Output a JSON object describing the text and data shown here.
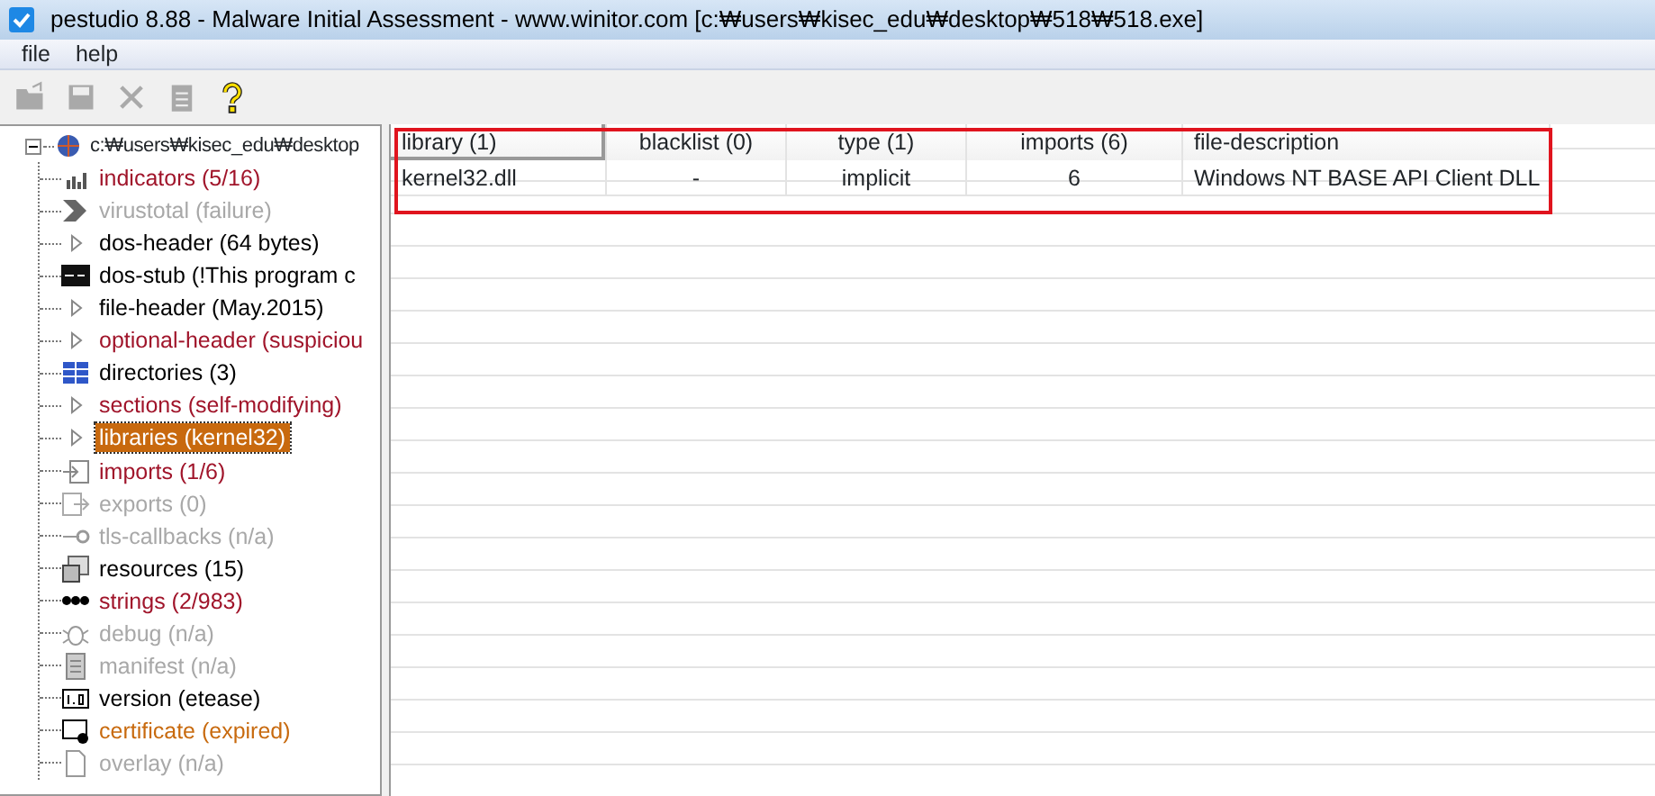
{
  "window": {
    "title": "pestudio 8.88 - Malware Initial Assessment - www.winitor.com [c:₩users₩kisec_edu₩desktop₩518₩518.exe]"
  },
  "menu": [
    "file",
    "help"
  ],
  "toolbar": [
    {
      "kind": "open",
      "disabled": true
    },
    {
      "kind": "save",
      "disabled": true
    },
    {
      "kind": "close",
      "disabled": true
    },
    {
      "kind": "clipboard",
      "disabled": true
    },
    {
      "kind": "help",
      "disabled": false
    }
  ],
  "tree": {
    "label": "c:₩users₩kisec_edu₩desktop",
    "expanded": true,
    "children": [
      {
        "label": "indicators (5/16)",
        "kind": "bars",
        "color": "#a0142a",
        "selected": false
      },
      {
        "label": "virustotal (failure)",
        "kind": "chevron",
        "color": "#a8a8a8",
        "selected": false
      },
      {
        "label": "dos-header (64 bytes)",
        "kind": "triangle",
        "color": "#000000",
        "selected": false
      },
      {
        "label": "dos-stub (!This program c",
        "kind": "console",
        "color": "#000000",
        "selected": false
      },
      {
        "label": "file-header (May.2015)",
        "kind": "triangle",
        "color": "#000000",
        "selected": false
      },
      {
        "label": "optional-header (suspiciou",
        "kind": "triangle",
        "color": "#a0142a",
        "selected": false
      },
      {
        "label": "directories (3)",
        "kind": "grid",
        "color": "#000000",
        "selected": false
      },
      {
        "label": "sections (self-modifying)",
        "kind": "triangle",
        "color": "#a0142a",
        "selected": false
      },
      {
        "label": "libraries (kernel32)",
        "kind": "triangle",
        "selected": true
      },
      {
        "label": "imports (1/6)",
        "kind": "import",
        "color": "#a0142a",
        "selected": false
      },
      {
        "label": "exports (0)",
        "kind": "export",
        "color": "#a8a8a8",
        "selected": false
      },
      {
        "label": "tls-callbacks (n/a)",
        "kind": "key",
        "color": "#a8a8a8",
        "selected": false
      },
      {
        "label": "resources (15)",
        "kind": "resources",
        "color": "#000000",
        "selected": false
      },
      {
        "label": "strings (2/983)",
        "kind": "abc",
        "color": "#a0142a",
        "selected": false
      },
      {
        "label": "debug (n/a)",
        "kind": "bug",
        "color": "#a8a8a8",
        "selected": false
      },
      {
        "label": "manifest (n/a)",
        "kind": "scroll",
        "color": "#a8a8a8",
        "selected": false
      },
      {
        "label": "version (etease)",
        "kind": "version",
        "color": "#000000",
        "selected": false
      },
      {
        "label": "certificate (expired)",
        "kind": "certificate",
        "color": "#c86a0e",
        "selected": false
      },
      {
        "label": "overlay (n/a)",
        "kind": "page",
        "color": "#a8a8a8",
        "selected": false
      }
    ]
  },
  "table": {
    "columns": [
      {
        "label": "library (1)",
        "sorted": true
      },
      {
        "label": "blacklist (0)",
        "sorted": false
      },
      {
        "label": "type (1)",
        "sorted": false
      },
      {
        "label": "imports (6)",
        "sorted": false
      },
      {
        "label": "file-description",
        "sorted": false
      }
    ],
    "rows": [
      [
        "kernel32.dll",
        "-",
        "implicit",
        "6",
        "Windows NT BASE API Client DLL"
      ]
    ]
  },
  "highlight": {
    "color": "#e0141e"
  }
}
